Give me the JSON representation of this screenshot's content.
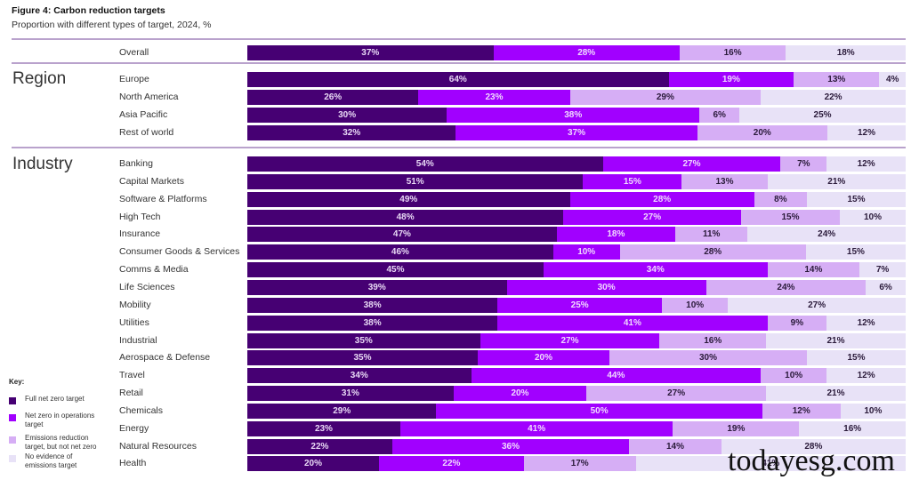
{
  "chart_data": {
    "type": "bar",
    "orientation": "horizontal",
    "stacked": true,
    "title": "Figure 4: Carbon reduction targets",
    "subtitle": "Proportion with different types of target, 2024, %",
    "xlabel": "",
    "ylabel": "",
    "xlim": [
      0,
      100
    ],
    "unit": "%",
    "legend_title": "Key:",
    "legend_position": "bottom-left",
    "series_names": [
      "Full net zero target",
      "Net zero in operations target",
      "Emissions reduction target, but not net zero",
      "No evidence of emissions target"
    ],
    "colors": [
      "#460073",
      "#a100ff",
      "#d6aef5",
      "#e8e2f7"
    ],
    "groups": [
      {
        "name": "",
        "rows": [
          {
            "label": "Overall",
            "values": [
              37,
              28,
              16,
              18
            ]
          }
        ]
      },
      {
        "name": "Region",
        "rows": [
          {
            "label": "Europe",
            "values": [
              64,
              19,
              13,
              4
            ]
          },
          {
            "label": "North America",
            "values": [
              26,
              23,
              29,
              22
            ]
          },
          {
            "label": "Asia Pacific",
            "values": [
              30,
              38,
              6,
              25
            ]
          },
          {
            "label": "Rest of world",
            "values": [
              32,
              37,
              20,
              12
            ]
          }
        ]
      },
      {
        "name": "Industry",
        "rows": [
          {
            "label": "Banking",
            "values": [
              54,
              27,
              7,
              12
            ]
          },
          {
            "label": "Capital Markets",
            "values": [
              51,
              15,
              13,
              21
            ]
          },
          {
            "label": "Software & Platforms",
            "values": [
              49,
              28,
              8,
              15
            ]
          },
          {
            "label": "High Tech",
            "values": [
              48,
              27,
              15,
              10
            ]
          },
          {
            "label": "Insurance",
            "values": [
              47,
              18,
              11,
              24
            ]
          },
          {
            "label": "Consumer Goods & Services",
            "values": [
              46,
              10,
              28,
              15
            ]
          },
          {
            "label": "Comms & Media",
            "values": [
              45,
              34,
              14,
              7
            ]
          },
          {
            "label": "Life Sciences",
            "values": [
              39,
              30,
              24,
              6
            ]
          },
          {
            "label": "Mobility",
            "values": [
              38,
              25,
              10,
              27
            ]
          },
          {
            "label": "Utilities",
            "values": [
              38,
              41,
              9,
              12
            ]
          },
          {
            "label": "Industrial",
            "values": [
              35,
              27,
              16,
              21
            ]
          },
          {
            "label": "Aerospace & Defense",
            "values": [
              35,
              20,
              30,
              15
            ]
          },
          {
            "label": "Travel",
            "values": [
              34,
              44,
              10,
              12
            ]
          },
          {
            "label": "Retail",
            "values": [
              31,
              20,
              27,
              21
            ]
          },
          {
            "label": "Chemicals",
            "values": [
              29,
              50,
              12,
              10
            ]
          },
          {
            "label": "Energy",
            "values": [
              23,
              41,
              19,
              16
            ]
          },
          {
            "label": "Natural Resources",
            "values": [
              22,
              36,
              14,
              28
            ]
          },
          {
            "label": "Health",
            "values": [
              20,
              22,
              17,
              41
            ]
          }
        ]
      }
    ]
  },
  "watermark": "todayesg.com"
}
